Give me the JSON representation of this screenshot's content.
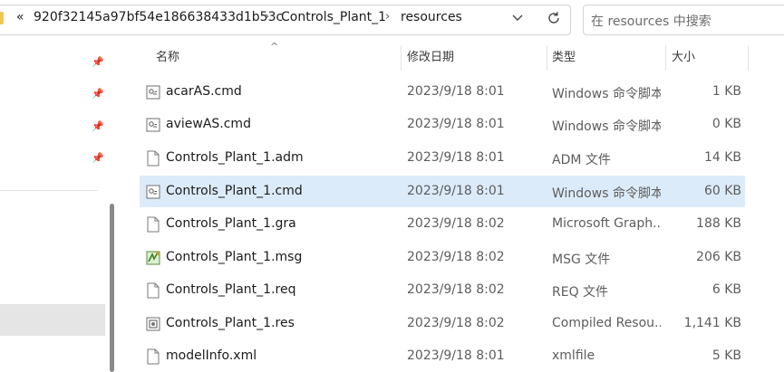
{
  "address": {
    "overflow": "«",
    "crumbs": [
      "920f32145a97bf54e186638433d1b53c",
      "Controls_Plant_1",
      "resources"
    ],
    "separator": "›"
  },
  "search": {
    "placeholder": "在 resources 中搜索"
  },
  "columns": {
    "name": "名称",
    "date": "修改日期",
    "type": "类型",
    "size": "大小"
  },
  "files": [
    {
      "name": "acarAS.cmd",
      "date": "2023/9/18 8:01",
      "type": "Windows 命令脚本",
      "size": "1 KB",
      "icon": "cmd-file-icon"
    },
    {
      "name": "aviewAS.cmd",
      "date": "2023/9/18 8:01",
      "type": "Windows 命令脚本",
      "size": "0 KB",
      "icon": "cmd-file-icon"
    },
    {
      "name": "Controls_Plant_1.adm",
      "date": "2023/9/18 8:01",
      "type": "ADM 文件",
      "size": "14 KB",
      "icon": "blank-file-icon"
    },
    {
      "name": "Controls_Plant_1.cmd",
      "date": "2023/9/18 8:01",
      "type": "Windows 命令脚本",
      "size": "60 KB",
      "icon": "cmd-file-icon"
    },
    {
      "name": "Controls_Plant_1.gra",
      "date": "2023/9/18 8:02",
      "type": "Microsoft Graph...",
      "size": "188 KB",
      "icon": "blank-file-icon"
    },
    {
      "name": "Controls_Plant_1.msg",
      "date": "2023/9/18 8:02",
      "type": "MSG 文件",
      "size": "206 KB",
      "icon": "msg-file-icon"
    },
    {
      "name": "Controls_Plant_1.req",
      "date": "2023/9/18 8:02",
      "type": "REQ 文件",
      "size": "6 KB",
      "icon": "blank-file-icon"
    },
    {
      "name": "Controls_Plant_1.res",
      "date": "2023/9/18 8:02",
      "type": "Compiled Resou...",
      "size": "1,141 KB",
      "icon": "res-file-icon"
    },
    {
      "name": "modelInfo.xml",
      "date": "2023/9/18 8:01",
      "type": "xmlfile",
      "size": "5 KB",
      "icon": "blank-file-icon"
    }
  ],
  "selected_index": 3,
  "colors": {
    "selected_row": "#dcebfa",
    "folder": "#f3c555"
  }
}
